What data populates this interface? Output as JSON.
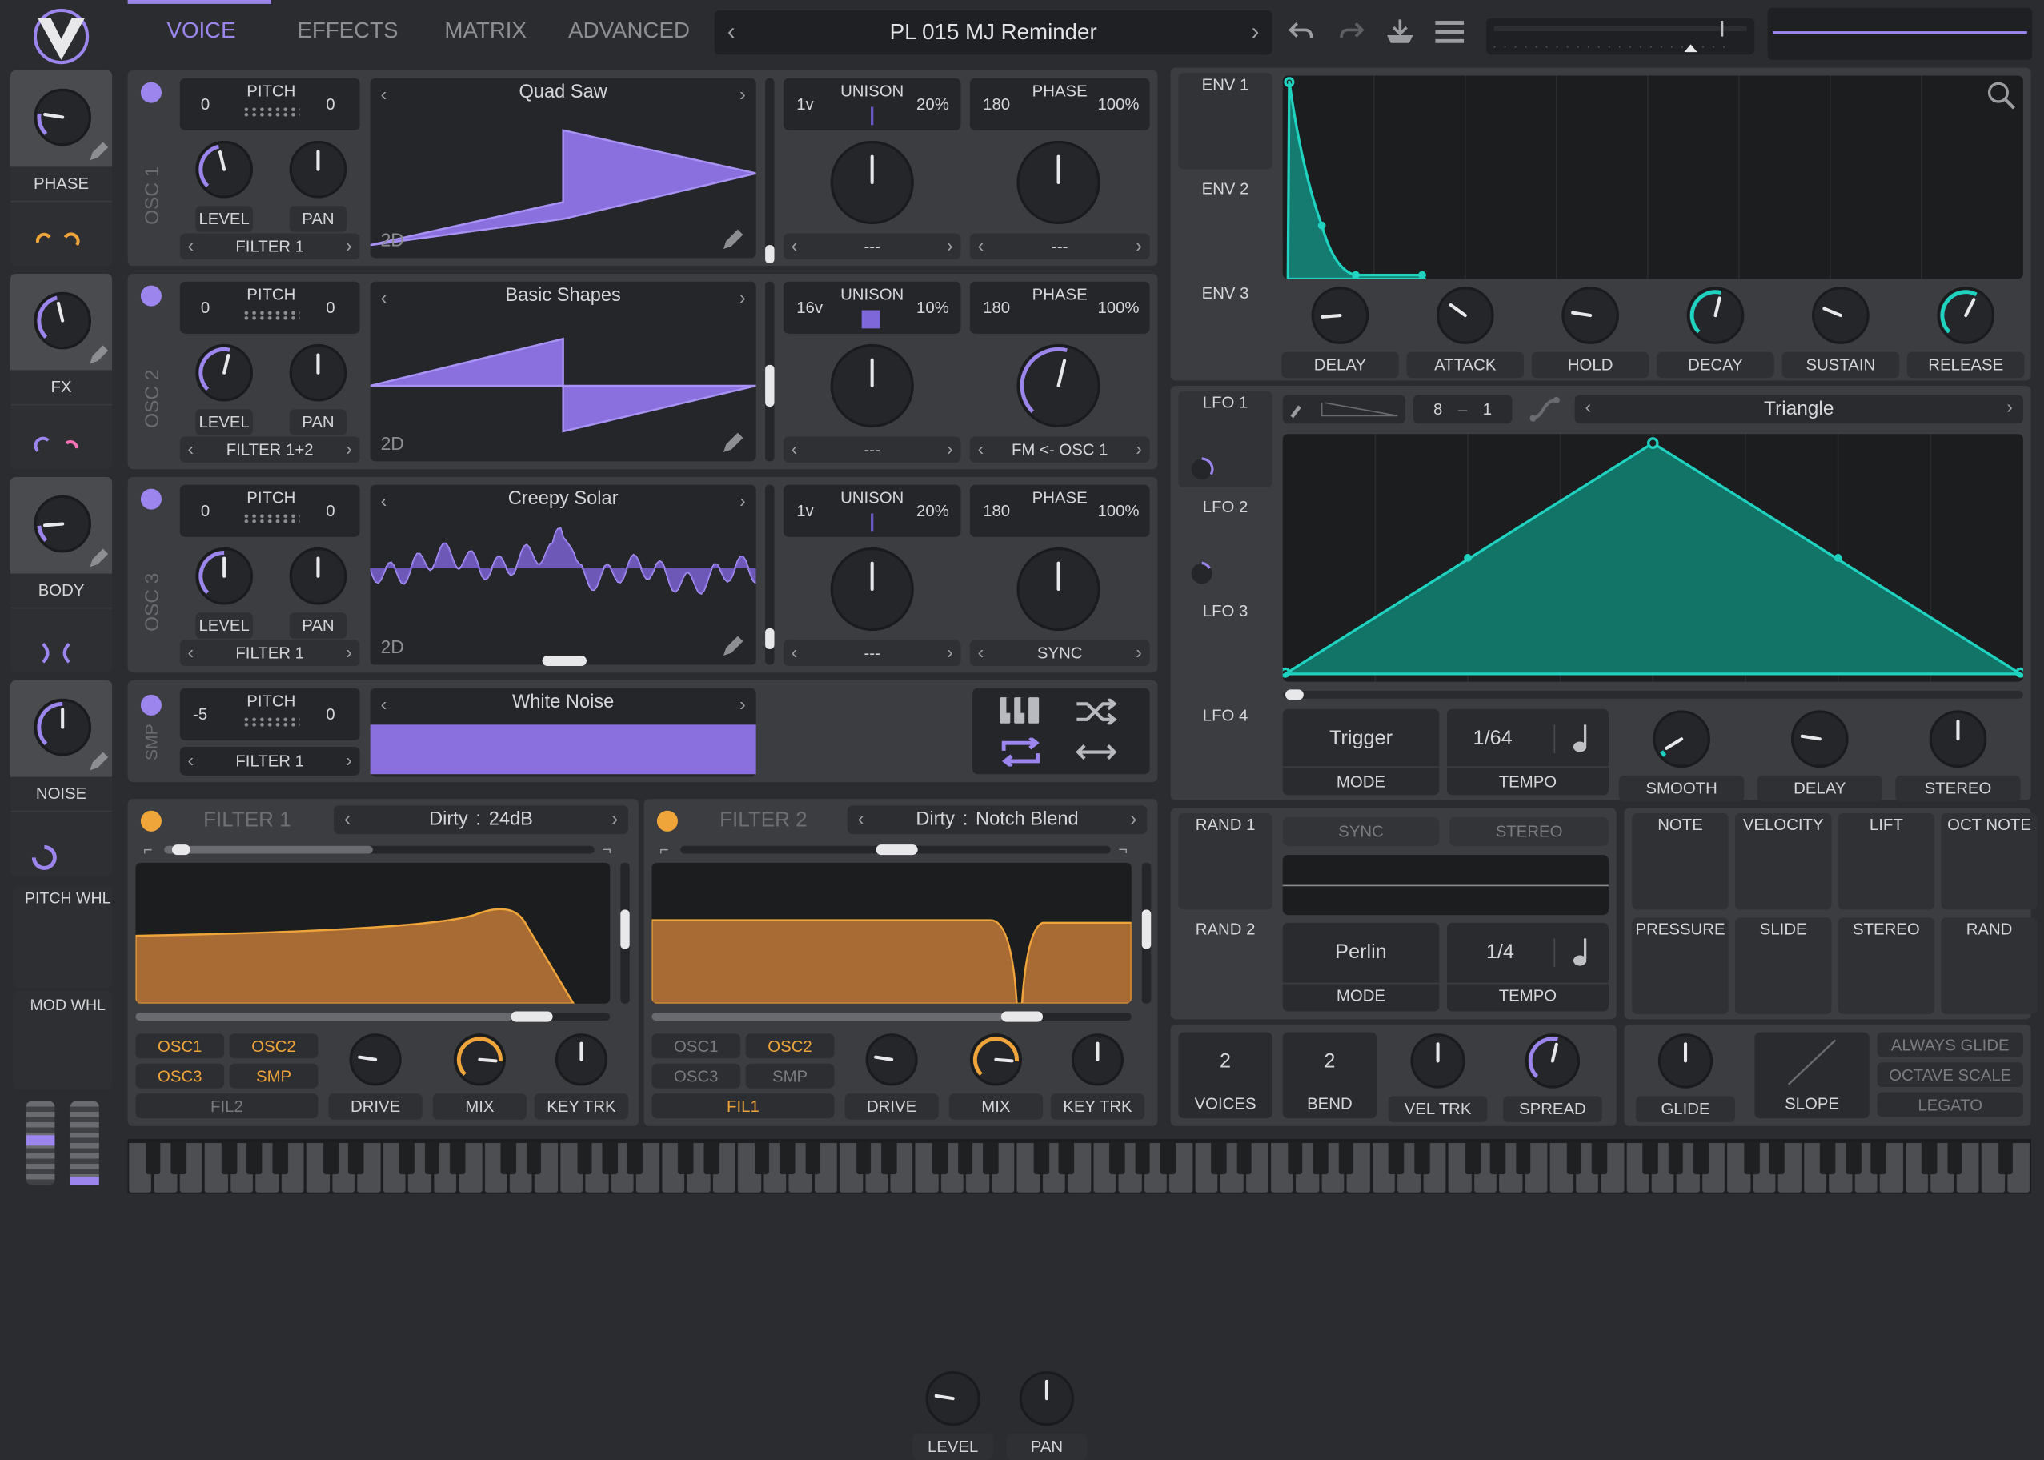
{
  "nav": {
    "tabs": [
      "VOICE",
      "EFFECTS",
      "MATRIX",
      "ADVANCED"
    ],
    "preset": "PL 015 MJ Reminder"
  },
  "macros": [
    {
      "label": "PHASE"
    },
    {
      "label": "FX"
    },
    {
      "label": "BODY"
    },
    {
      "label": "NOISE"
    }
  ],
  "wheels": {
    "pitch": "PITCH WHL",
    "mod": "MOD WHL"
  },
  "osc": [
    {
      "name": "OSC 1",
      "pitch_label": "PITCH",
      "pitch_l": "0",
      "pitch_r": "0",
      "wave": "Quad Saw",
      "dim": "2D",
      "level": "LEVEL",
      "pan": "PAN",
      "dest": "FILTER 1",
      "uni_voices": "1v",
      "uni_label": "UNISON",
      "uni_pct": "20%",
      "ph_val": "180",
      "ph_label": "PHASE",
      "ph_pct": "100%",
      "mod1": "---",
      "mod2": "---"
    },
    {
      "name": "OSC 2",
      "pitch_label": "PITCH",
      "pitch_l": "0",
      "pitch_r": "0",
      "wave": "Basic Shapes",
      "dim": "2D",
      "level": "LEVEL",
      "pan": "PAN",
      "dest": "FILTER 1+2",
      "uni_voices": "16v",
      "uni_label": "UNISON",
      "uni_pct": "10%",
      "ph_val": "180",
      "ph_label": "PHASE",
      "ph_pct": "100%",
      "mod1": "---",
      "mod2": "FM <- OSC 1"
    },
    {
      "name": "OSC 3",
      "pitch_label": "PITCH",
      "pitch_l": "0",
      "pitch_r": "0",
      "wave": "Creepy Solar",
      "dim": "2D",
      "level": "LEVEL",
      "pan": "PAN",
      "dest": "FILTER 1",
      "uni_voices": "1v",
      "uni_label": "UNISON",
      "uni_pct": "20%",
      "ph_val": "180",
      "ph_label": "PHASE",
      "ph_pct": "100%",
      "mod1": "---",
      "mod2": "SYNC"
    }
  ],
  "smp": {
    "name": "SMP",
    "pitch_label": "PITCH",
    "pitch_l": "-5",
    "pitch_r": "0",
    "dest": "FILTER 1",
    "wave": "White Noise",
    "level": "LEVEL",
    "pan": "PAN"
  },
  "filters": [
    {
      "name": "FILTER 1",
      "model": "Dirty",
      "sep": ":",
      "type": "24dB",
      "drive": "DRIVE",
      "mix": "MIX",
      "key": "KEY TRK",
      "srcs": [
        "OSC1",
        "OSC2",
        "OSC3",
        "SMP"
      ],
      "route": "FIL2"
    },
    {
      "name": "FILTER 2",
      "model": "Dirty",
      "sep": ":",
      "type": "Notch Blend",
      "drive": "DRIVE",
      "mix": "MIX",
      "key": "KEY TRK",
      "srcs": [
        "OSC1",
        "OSC2",
        "OSC3",
        "SMP"
      ],
      "route": "FIL1"
    }
  ],
  "env": {
    "tabs": [
      "ENV 1",
      "ENV 2",
      "ENV 3"
    ],
    "knobs": [
      "DELAY",
      "ATTACK",
      "HOLD",
      "DECAY",
      "SUSTAIN",
      "RELEASE"
    ]
  },
  "lfo": {
    "tabs": [
      "LFO 1",
      "LFO 2",
      "LFO 3",
      "LFO 4"
    ],
    "num": "8",
    "sep": "–",
    "den": "1",
    "shape": "Triangle",
    "mode": "Trigger",
    "mode_label": "MODE",
    "tempo": "1/64",
    "tempo_label": "TEMPO",
    "knobs": [
      "SMOOTH",
      "DELAY",
      "STEREO"
    ]
  },
  "rand": {
    "tabs": [
      "RAND 1",
      "RAND 2"
    ],
    "sync": "SYNC",
    "stereo": "STEREO",
    "mode": "Perlin",
    "mode_label": "MODE",
    "tempo": "1/4",
    "tempo_label": "TEMPO"
  },
  "mods": [
    "NOTE",
    "VELOCITY",
    "LIFT",
    "OCT NOTE",
    "PRESSURE",
    "SLIDE",
    "STEREO",
    "RAND"
  ],
  "voice": {
    "voices": "2",
    "voices_label": "VOICES",
    "bend": "2",
    "bend_label": "BEND",
    "veltrk": "VEL TRK",
    "spread": "SPREAD"
  },
  "glide": {
    "glide": "GLIDE",
    "slope": "SLOPE",
    "opts": [
      "ALWAYS GLIDE",
      "OCTAVE SCALE",
      "LEGATO"
    ]
  },
  "colors": {
    "accent": "#9c86ee",
    "teal": "#17c2b0",
    "orange": "#f0a53a",
    "panel": "#3c3d41",
    "dark": "#25262a"
  }
}
